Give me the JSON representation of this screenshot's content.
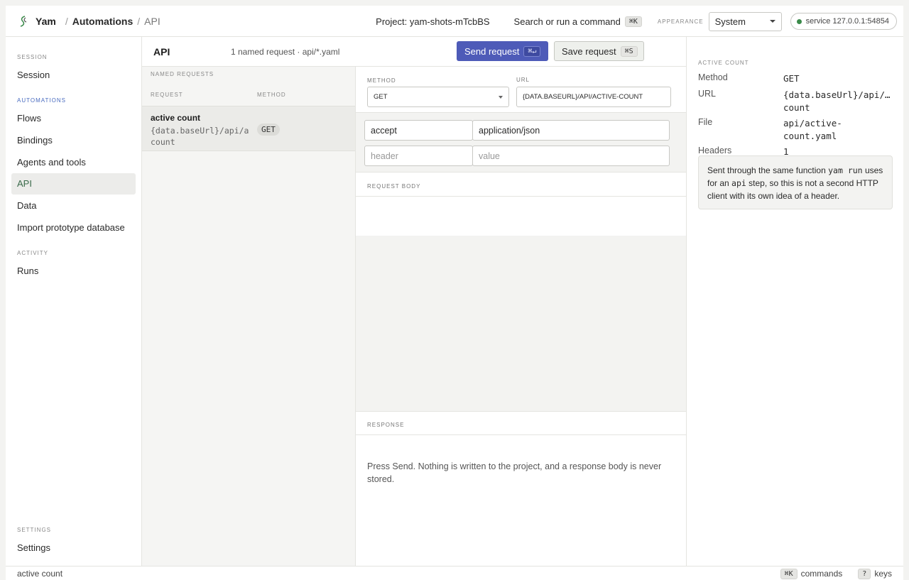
{
  "topbar": {
    "brand": "Yam",
    "breadcrumb": [
      "Automations",
      "API"
    ],
    "project": "Project: yam-shots-mTcbBS",
    "search_label": "Search or run a command",
    "search_kbd": "⌘K",
    "appearance_label": "APPEARANCE",
    "appearance_value": "System",
    "service": "service 127.0.0.1:54854"
  },
  "sidebar": {
    "sections": {
      "session": "SESSION",
      "automations": "AUTOMATIONS",
      "activity": "ACTIVITY",
      "settings": "SETTINGS"
    },
    "items": {
      "session": "Session",
      "flows": "Flows",
      "bindings": "Bindings",
      "agents": "Agents and tools",
      "api": "API",
      "data": "Data",
      "import": "Import prototype database",
      "runs": "Runs",
      "settings": "Settings"
    }
  },
  "main": {
    "title": "API",
    "subtitle": "1 named request · api/*.yaml",
    "send_label": "Send request",
    "send_kbd": "⌘↵",
    "save_label": "Save request",
    "save_kbd": "⌘S",
    "list": {
      "heading": "NAMED REQUESTS",
      "col_request": "REQUEST",
      "col_method": "METHOD",
      "rows": [
        {
          "name": "active count",
          "url_line1": "{data.baseUrl}/api/a",
          "url_line2": "count",
          "method": "GET"
        }
      ]
    },
    "editor": {
      "method_label": "METHOD",
      "method_value": "GET",
      "url_label": "URL",
      "url_value": "{DATA.BASEURL}/API/ACTIVE-COUNT",
      "headers": [
        {
          "name": "accept",
          "value": "application/json"
        }
      ],
      "header_placeholder": "header",
      "value_placeholder": "value",
      "body_label": "REQUEST BODY",
      "response_label": "RESPONSE",
      "response_text": "Press Send. Nothing is written to the project, and a response body is never stored."
    }
  },
  "inspector": {
    "heading": "ACTIVE COUNT",
    "method_key": "Method",
    "method_value": "GET",
    "url_key": "URL",
    "url_line1": "{data.baseUrl}/api/…",
    "url_line2": "count",
    "file_key": "File",
    "file_line1": "api/active-",
    "file_line2": "count.yaml",
    "headers_key": "Headers",
    "headers_value": "1",
    "note_pre": "Sent through the same function",
    "note_code1": "yam run",
    "note_mid": "uses for an",
    "note_code2": "api",
    "note_post": "step, so this is not a second HTTP client with its own idea of a header."
  },
  "statusbar": {
    "left": "active count",
    "commands_kbd": "⌘K",
    "commands_label": "commands",
    "keys_kbd": "?",
    "keys_label": "keys"
  },
  "colors": {
    "accent": "#4e5bb8",
    "status_ok": "#3a8a4a"
  }
}
